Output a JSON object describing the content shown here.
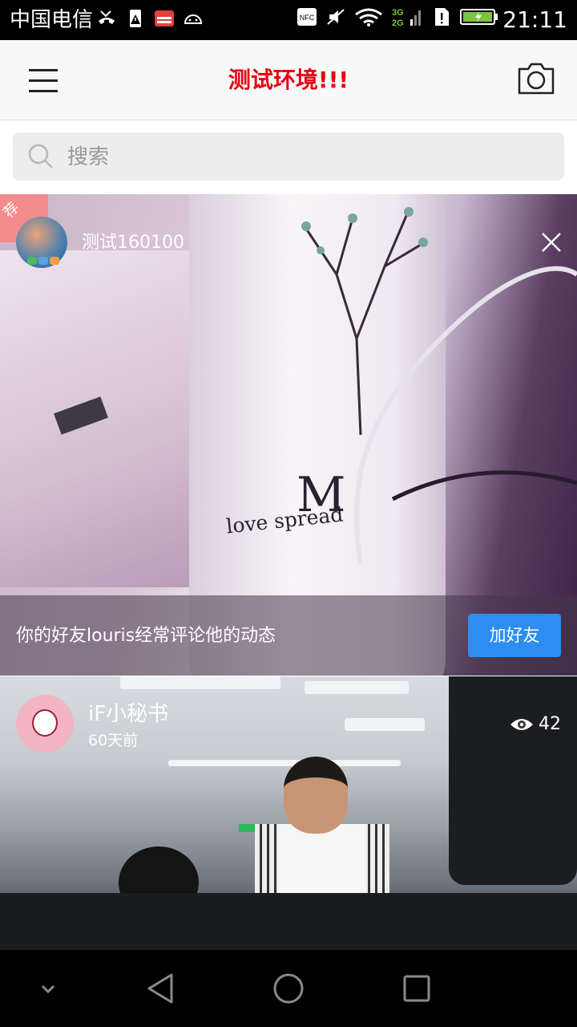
{
  "status_bar": {
    "carrier": "中国电信",
    "time": "21:11",
    "icons_left": [
      "missed-call-icon",
      "storage-warning-icon",
      "radio-icon",
      "android-icon"
    ],
    "icons_right": [
      "nfc-icon",
      "mute-icon",
      "wifi-icon",
      "signal-3g-2g-icon",
      "sim-alert-icon",
      "battery-charging-icon"
    ],
    "network_labels": {
      "top": "3G",
      "bottom": "2G"
    },
    "nfc_label": "NFC"
  },
  "header": {
    "title": "测试环境!!!",
    "title_color": "#e60012",
    "menu_icon": "hamburger-menu-icon",
    "camera_icon": "camera-icon"
  },
  "search": {
    "placeholder": "搜索",
    "icon": "search-icon"
  },
  "feed": [
    {
      "type": "recommendation",
      "badge": "荐",
      "user_name": "测试160100",
      "text_m": "M",
      "text_love": "love spread",
      "footer_text": "你的好友louris经常评论他的动态",
      "action_label": "加好友",
      "action_color": "#2d8df0"
    },
    {
      "type": "post",
      "user_name": "iF小秘书",
      "time_ago": "60天前",
      "view_count": "42"
    }
  ],
  "nav_bar": {
    "buttons": [
      "collapse-icon",
      "back-icon",
      "home-icon",
      "recent-apps-icon"
    ]
  }
}
